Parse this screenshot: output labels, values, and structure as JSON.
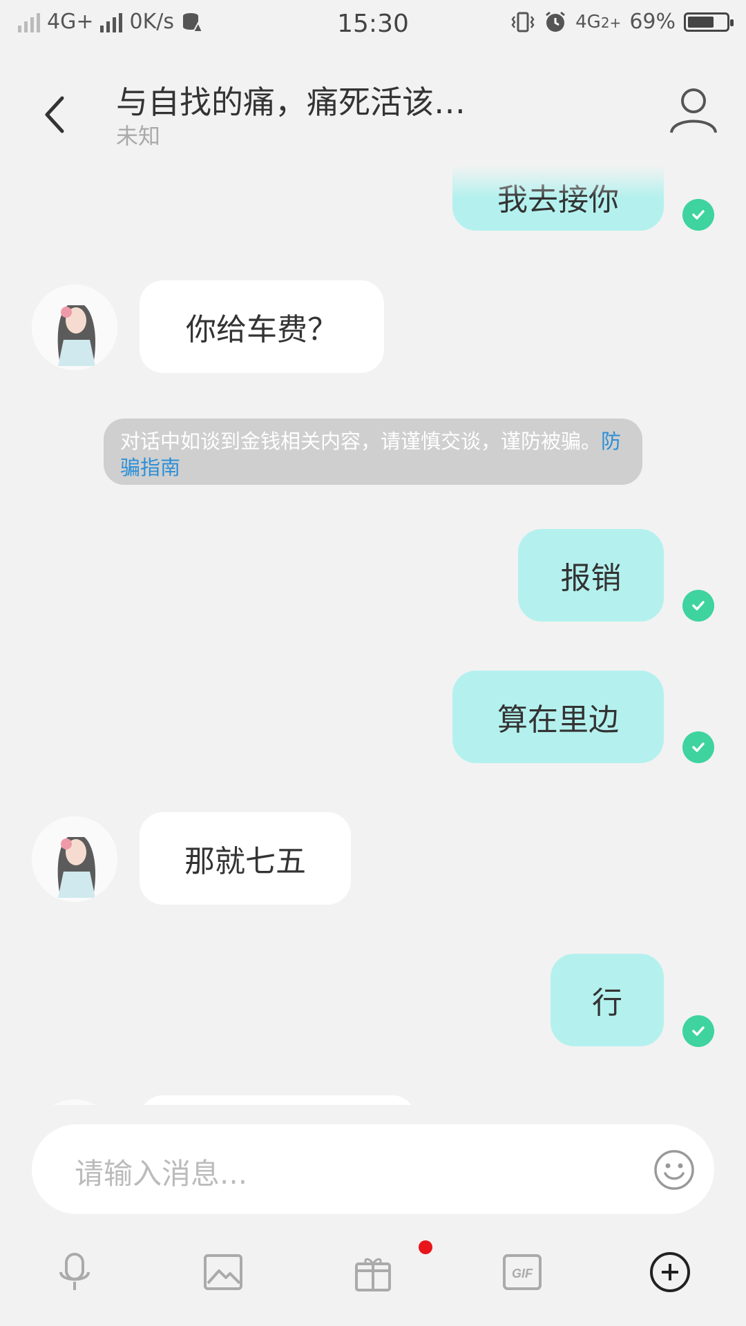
{
  "status_bar": {
    "network_left": "4G+",
    "speed": "0K/s",
    "time": "15:30",
    "network_right": "4G",
    "network_right_sub": "2+",
    "battery": "69%",
    "battery_level": 0.69
  },
  "header": {
    "title": "与自找的痛，痛死活该…",
    "subtitle": "未知"
  },
  "messages": [
    {
      "dir": "out",
      "text": "我去接你"
    },
    {
      "dir": "in",
      "text": "你给车费？"
    },
    {
      "dir": "out",
      "text": "报销"
    },
    {
      "dir": "out",
      "text": "算在里边"
    },
    {
      "dir": "in",
      "text": "那就七五"
    },
    {
      "dir": "out",
      "text": "行"
    }
  ],
  "notice": {
    "text": "对话中如谈到金钱相关内容，请谨慎交谈，谨防被骗。",
    "link": "防骗指南"
  },
  "input": {
    "placeholder": "请输入消息..."
  },
  "toolbar": {
    "icons": [
      "microphone-icon",
      "image-icon",
      "gift-icon",
      "gif-icon",
      "plus-circle-icon"
    ]
  },
  "colors": {
    "outgoing_bubble": "#b4f1ee",
    "incoming_bubble": "#ffffff",
    "check": "#3ed39f",
    "link": "#2b8fd6",
    "badge": "#e8151b"
  }
}
